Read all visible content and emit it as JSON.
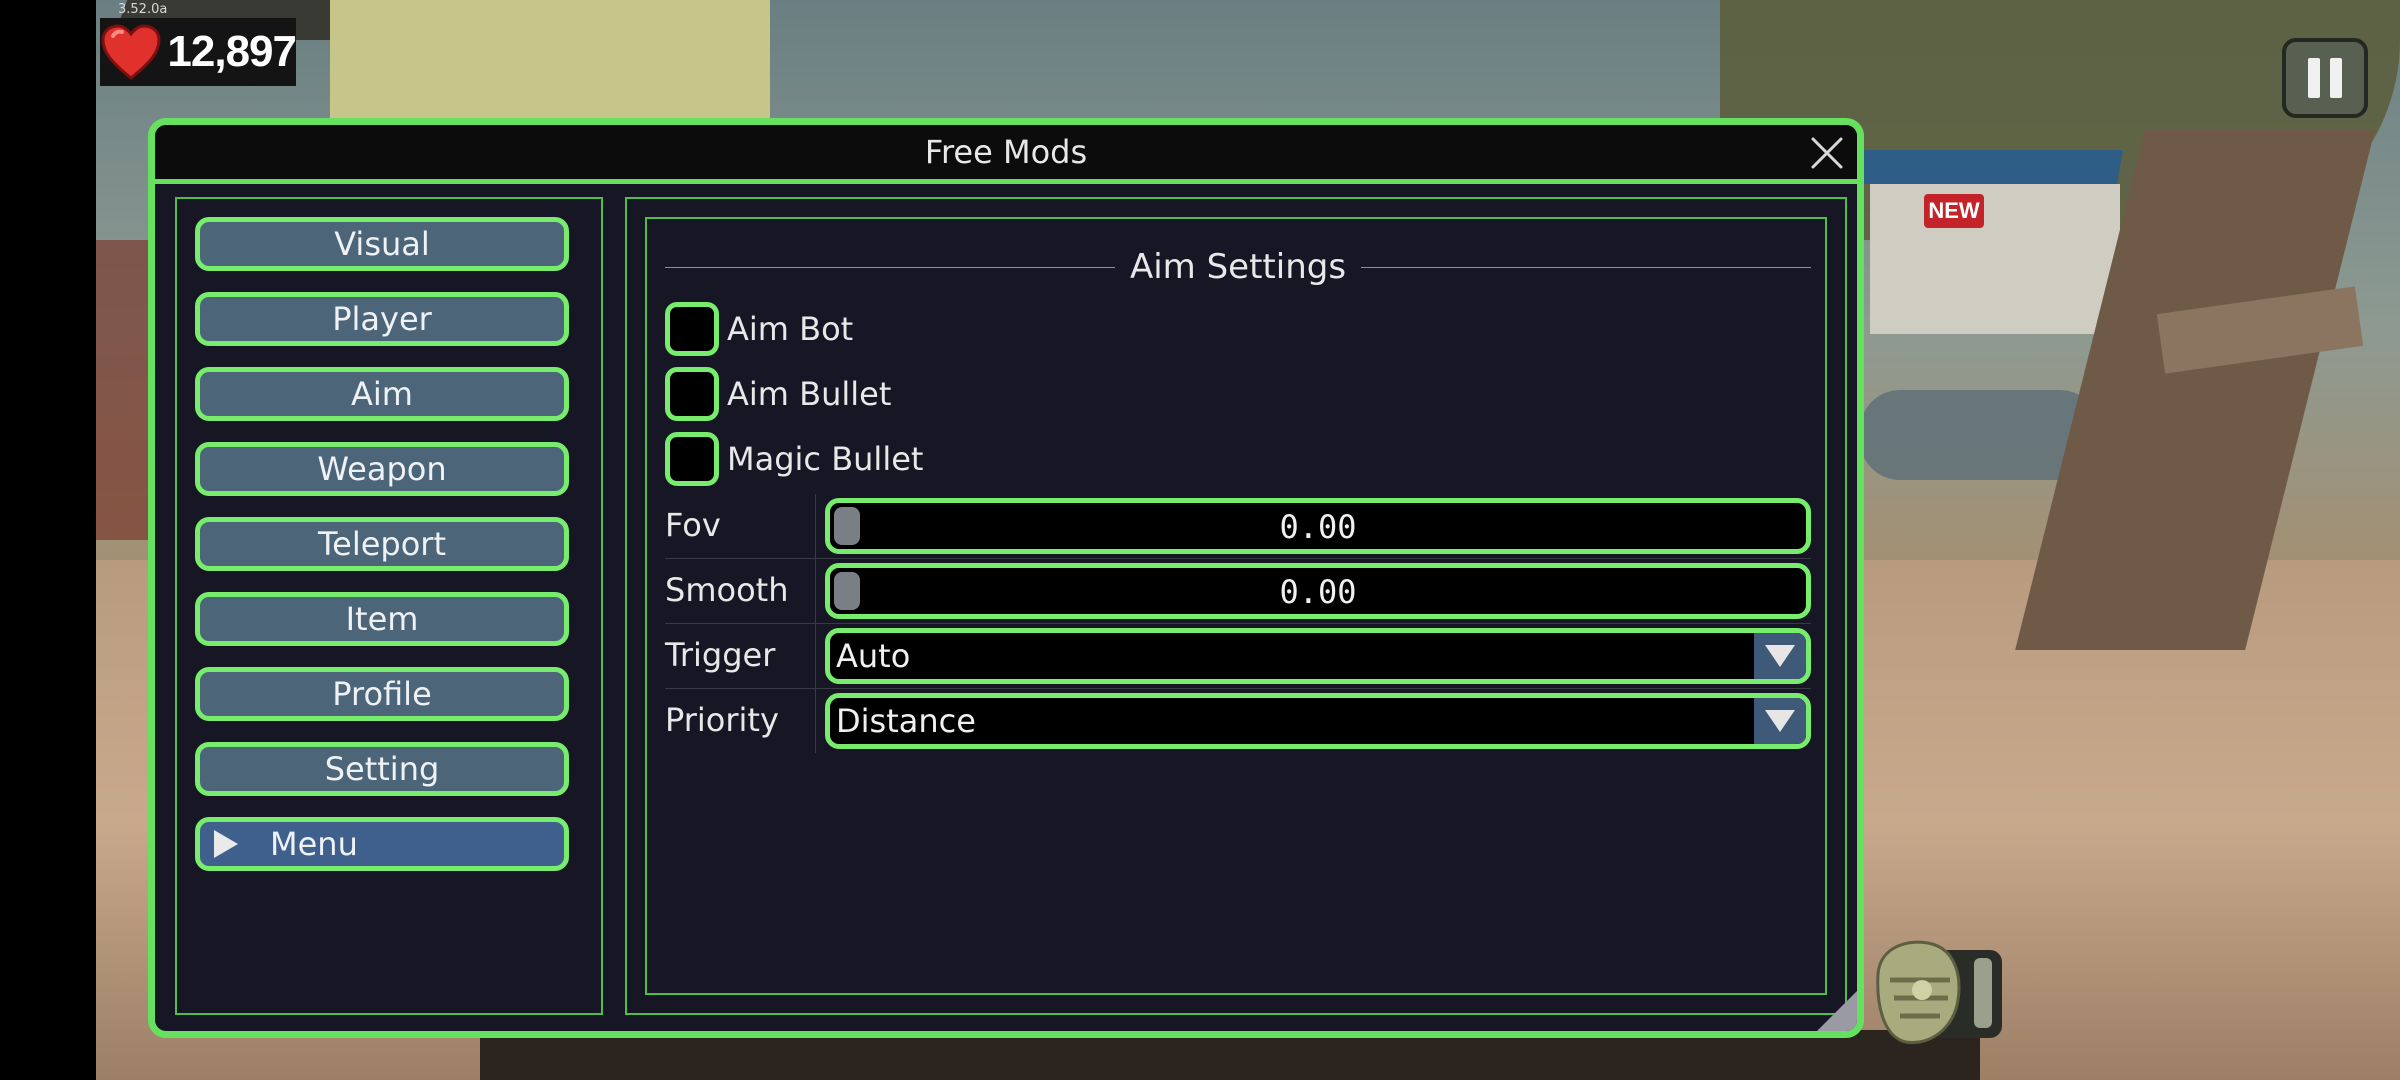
{
  "hud": {
    "version": "3.52.0a",
    "health_value": "12,897",
    "new_badge": "NEW"
  },
  "window": {
    "title": "Free Mods",
    "nav": [
      {
        "label": "Visual"
      },
      {
        "label": "Player"
      },
      {
        "label": "Aim"
      },
      {
        "label": "Weapon"
      },
      {
        "label": "Teleport"
      },
      {
        "label": "Item"
      },
      {
        "label": "Profile"
      },
      {
        "label": "Setting"
      },
      {
        "label": "Menu"
      }
    ]
  },
  "aim": {
    "section_title": "Aim Settings",
    "checks": [
      {
        "label": "Aim Bot",
        "checked": false
      },
      {
        "label": "Aim Bullet",
        "checked": false
      },
      {
        "label": "Magic Bullet",
        "checked": false
      }
    ],
    "fov": {
      "label": "Fov",
      "value": "0.00"
    },
    "smooth": {
      "label": "Smooth",
      "value": "0.00"
    },
    "trigger": {
      "label": "Trigger",
      "value": "Auto"
    },
    "priority": {
      "label": "Priority",
      "value": "Distance"
    }
  },
  "colors": {
    "accent_green": "#66e05f",
    "panel_bg": "#171624",
    "nav_button": "#4c6579",
    "menu_button": "#3f5f8c",
    "dropdown_arrow_bg": "#3f5a78"
  },
  "icons": [
    "heart-icon",
    "pause-icon",
    "close-icon",
    "play-arrow-icon",
    "dropdown-arrow-icon",
    "backpack-icon"
  ]
}
